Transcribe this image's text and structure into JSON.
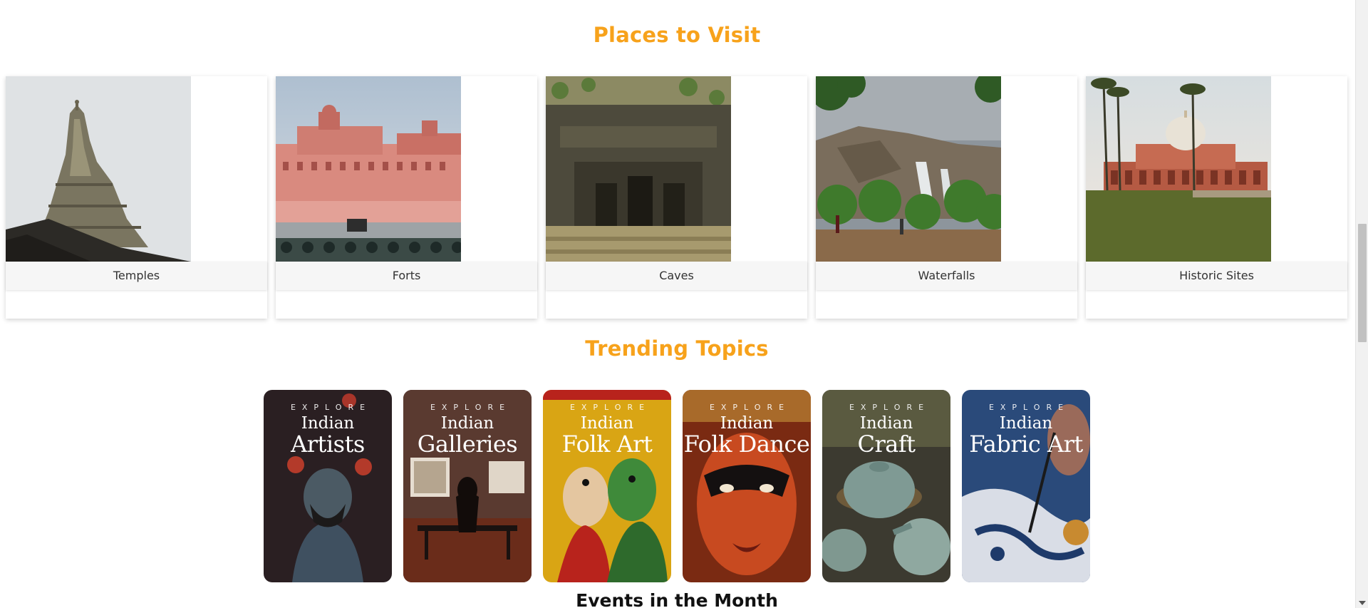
{
  "places": {
    "title": "Places to Visit",
    "items": [
      {
        "label": "Temples"
      },
      {
        "label": "Forts"
      },
      {
        "label": "Caves"
      },
      {
        "label": "Waterfalls"
      },
      {
        "label": "Historic Sites"
      }
    ]
  },
  "trending": {
    "title": "Trending Topics",
    "items": [
      {
        "explore": "EXPLORE",
        "line1": "Indian",
        "line2": "Artists"
      },
      {
        "explore": "EXPLORE",
        "line1": "Indian",
        "line2": "Galleries"
      },
      {
        "explore": "EXPLORE",
        "line1": "Indian",
        "line2": "Folk Art"
      },
      {
        "explore": "EXPLORE",
        "line1": "Indian",
        "line2": "Folk Dance"
      },
      {
        "explore": "EXPLORE",
        "line1": "Indian",
        "line2": "Craft"
      },
      {
        "explore": "EXPLORE",
        "line1": "Indian",
        "line2": "Fabric Art"
      }
    ]
  },
  "events": {
    "title": "Events in the Month"
  },
  "colors": {
    "accent": "#f7a21b"
  }
}
